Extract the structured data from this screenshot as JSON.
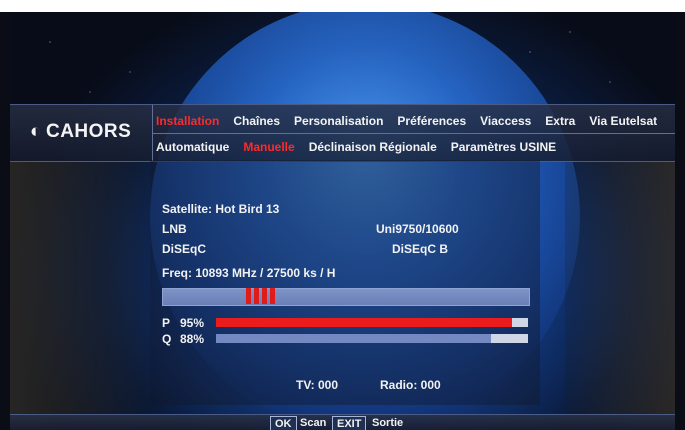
{
  "brand": {
    "name": "CAHORS"
  },
  "menu": {
    "top": [
      {
        "label": "Installation",
        "active": true
      },
      {
        "label": "Chaînes",
        "active": false
      },
      {
        "label": "Personalisation",
        "active": false
      },
      {
        "label": "Préférences",
        "active": false
      },
      {
        "label": "Viaccess",
        "active": false
      },
      {
        "label": "Extra",
        "active": false
      },
      {
        "label": "Via Eutelsat",
        "active": false
      }
    ],
    "sub": [
      {
        "label": "Automatique",
        "active": false
      },
      {
        "label": "Manuelle",
        "active": true
      },
      {
        "label": "Déclinaison Régionale",
        "active": false
      },
      {
        "label": "Paramètres USINE",
        "active": false
      }
    ]
  },
  "info": {
    "satellite": "Satellite: Hot Bird 13",
    "lnb_label": "LNB",
    "lnb_value": "Uni9750/10600",
    "diseqc_label": "DiSEqC",
    "diseqc_value": "DiSEqC B",
    "freq": "Freq: 10893 MHz  / 27500 ks / H"
  },
  "signal": {
    "p_label": "P",
    "p_value": "95%",
    "p_level": 0.95,
    "q_label": "Q",
    "q_value": "88%",
    "q_level": 0.88
  },
  "counts": {
    "tv": "TV: 000",
    "radio": "Radio: 000"
  },
  "footer": {
    "ok_key": "OK",
    "ok_label": "Scan",
    "exit_key": "EXIT",
    "exit_label": "Sortie"
  },
  "colors": {
    "active": "#ff2a2a",
    "meter_red": "#ea1c1c",
    "meter_blue": "#7488c2"
  }
}
